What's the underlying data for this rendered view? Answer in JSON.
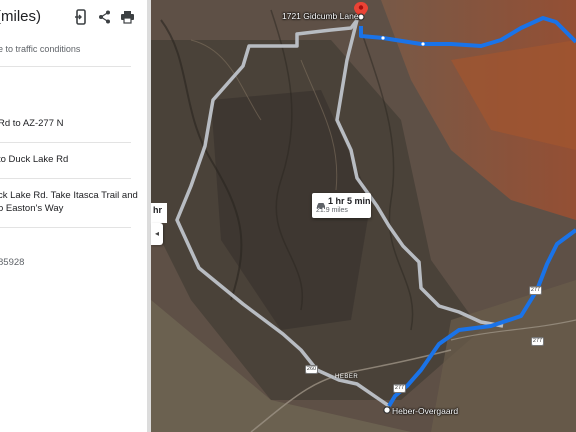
{
  "panel": {
    "title": "miles)",
    "subtitle": "e to traffic conditions",
    "step_marker": "",
    "steps": [
      "Rd to AZ-277 N",
      "to Duck Lake Rd",
      "ck Lake Rd. Take Itasca Trail and",
      "o Easton's Way"
    ],
    "footer_number": "85928",
    "icons": [
      "send-to-phone-icon",
      "share-icon",
      "print-icon"
    ]
  },
  "map": {
    "time_box": {
      "duration": "1 hr 5 min",
      "distance": "21.9 miles",
      "icon": "car-icon"
    },
    "side_time": "hr",
    "collapse_glyph": "◂",
    "destination_label": "1721 Gidcumb Lane",
    "origin_label": "Heber-Overgaard",
    "town_label": "HEBER",
    "shields": [
      "277",
      "277",
      "277",
      "260"
    ],
    "colors": {
      "primary_route": "#1a73e8",
      "alt_route": "#b8bcc2",
      "pin": "#ea4335"
    }
  }
}
